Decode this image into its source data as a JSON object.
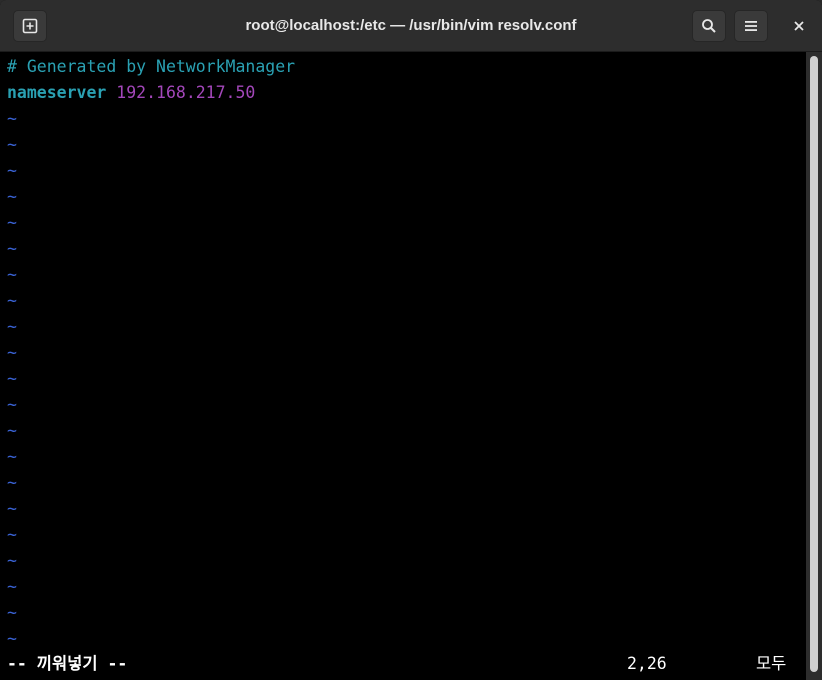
{
  "window": {
    "title": "root@localhost:/etc — /usr/bin/vim resolv.conf"
  },
  "titlebar": {
    "buttons": [
      {
        "icon": "new-tab-icon"
      },
      {
        "icon": "search-icon"
      },
      {
        "icon": "menu-icon"
      },
      {
        "icon": "close-icon"
      }
    ]
  },
  "editor": {
    "lines": {
      "comment": "# Generated by NetworkManager",
      "keyword": "nameserver",
      "value": "192.168.217.50"
    },
    "empty_marker": "~",
    "status": {
      "mode": "-- 끼워넣기 --",
      "cursor_position": "2,26",
      "scroll_position": "모두"
    }
  },
  "colors": {
    "comment": "#2aa1b3",
    "keyword": "#2aa1b3",
    "ip": "#a347ba",
    "tilde": "#3a63d6",
    "background": "#000000",
    "titlebar": "#2d2d2d"
  }
}
